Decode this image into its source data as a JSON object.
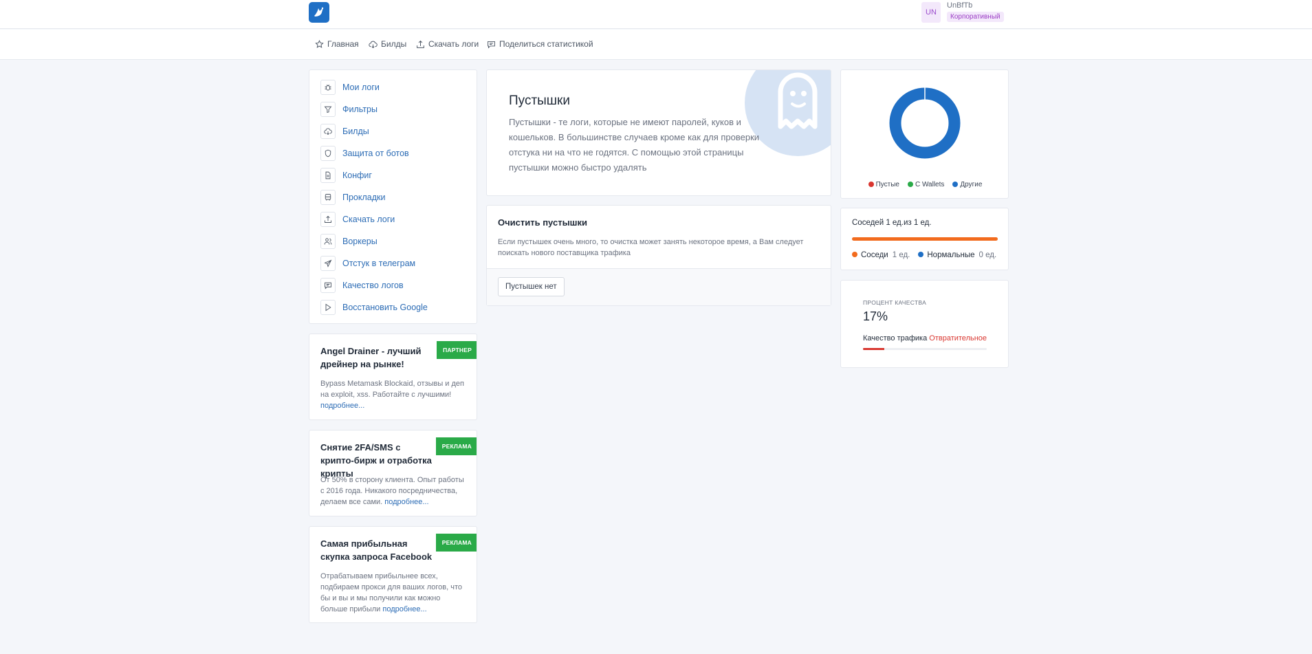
{
  "header": {
    "user_initials": "UN",
    "user_name": "UnBfTb",
    "user_plan": "Корпоративный"
  },
  "nav": {
    "home": "Главная",
    "builds": "Билды",
    "download_logs": "Скачать логи",
    "share_stats": "Поделиться статистикой"
  },
  "sidebar": {
    "items": [
      {
        "label": "Мои логи",
        "icon": "bug-icon"
      },
      {
        "label": "Фильтры",
        "icon": "filter-icon"
      },
      {
        "label": "Билды",
        "icon": "cloud-download-icon"
      },
      {
        "label": "Защита от ботов",
        "icon": "shield-icon"
      },
      {
        "label": "Конфиг",
        "icon": "file-icon"
      },
      {
        "label": "Прокладки",
        "icon": "bus-icon"
      },
      {
        "label": "Скачать логи",
        "icon": "upload-icon"
      },
      {
        "label": "Воркеры",
        "icon": "users-icon"
      },
      {
        "label": "Отстук в телеграм",
        "icon": "send-icon"
      },
      {
        "label": "Качество логов",
        "icon": "message-icon"
      },
      {
        "label": "Восстановить Google",
        "icon": "play-icon"
      }
    ]
  },
  "ads": [
    {
      "title": "Angel Drainer - лучший дрейнер на рынке!",
      "text": "Bypass Metamask Blockaid, отзывы и деп на exploit, xss. Работайте с лучшими!",
      "more": "подробнее...",
      "ribbon": "ПАРТНЕР"
    },
    {
      "title": "Снятие 2FA/SMS с крипто-бирж и отработка крипты",
      "text": "От 50% в сторону клиента. Опыт работы с 2016 года. Никакого посредничества, делаем все сами.",
      "more": "подробнее...",
      "ribbon": "РЕКЛАМА"
    },
    {
      "title": "Самая прибыльная скупка запроса Facebook",
      "text": "Отрабатываем прибыльнее всех, подбираем прокси для ваших логов, что бы и вы и мы получили как можно больше прибыли",
      "more": "подробнее...",
      "ribbon": "РЕКЛАМА"
    }
  ],
  "hero": {
    "title": "Пустышки",
    "text": "Пустышки - те логи, которые не имеют паролей, куков и кошельков. В большинстве случаев кроме как для проверки отстука ни на что не годятся. С помощью этой страницы пустышки можно быстро удалять"
  },
  "clear": {
    "title": "Очистить пустышки",
    "text": "Если пустышек очень много, то очистка может занять некоторое время, а Вам следует поискать нового поставщика трафика",
    "button": "Пустышек нет"
  },
  "donut": {
    "legend": [
      {
        "label": "Пустые",
        "color": "#d9362f",
        "value": 0
      },
      {
        "label": "С Wallets",
        "color": "#2aaa48",
        "value": 0
      },
      {
        "label": "Другие",
        "color": "#1f6fc5",
        "value": 1
      }
    ]
  },
  "neighbors": {
    "head_prefix": "Соседей",
    "head_count": "1 ед.",
    "head_of": "из 1 ед.",
    "fill_fraction": 1.0,
    "items": [
      {
        "label": "Соседи",
        "count": "1 ед.",
        "color": "#f26b1d"
      },
      {
        "label": "Нормальные",
        "count": "0 ед.",
        "color": "#1f6fc5"
      }
    ]
  },
  "quality": {
    "label": "ПРОЦЕНТ КАЧЕСТВА",
    "value": "17%",
    "fill_fraction": 0.17,
    "traffic_label": "Качество трафика",
    "traffic_value": "Отвратительное"
  }
}
